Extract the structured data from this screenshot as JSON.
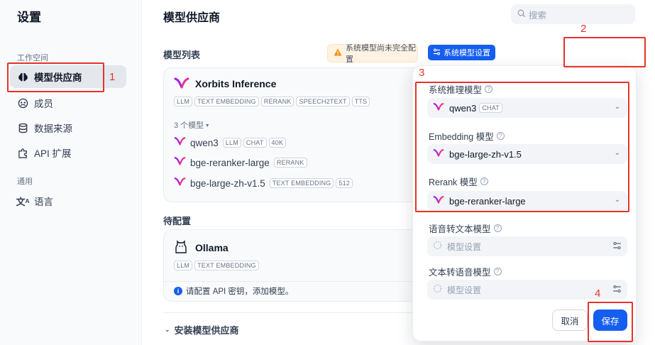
{
  "sidebar": {
    "title": "设置",
    "group_workspace": "工作空间",
    "group_general": "通用",
    "items": [
      {
        "label": "模型供应商"
      },
      {
        "label": "成员"
      },
      {
        "label": "数据来源"
      },
      {
        "label": "API 扩展"
      },
      {
        "label": "语言"
      }
    ]
  },
  "main": {
    "title": "模型供应商",
    "search_placeholder": "搜索",
    "model_list_label": "模型列表",
    "warning_text": "系统模型尚未完全配置",
    "system_model_button": "系统模型设置",
    "pending_label": "待配置",
    "install_label": "安装模型供应商"
  },
  "xorbits": {
    "name": "Xorbits Inference",
    "tags": [
      "LLM",
      "TEXT EMBEDDING",
      "RERANK",
      "SPEECH2TEXT",
      "TTS"
    ],
    "models_count": "3 个模型",
    "models": [
      {
        "name": "qwen3",
        "tags": [
          "LLM",
          "CHAT",
          "40K"
        ]
      },
      {
        "name": "bge-reranker-large",
        "tags": [
          "RERANK"
        ]
      },
      {
        "name": "bge-large-zh-v1.5",
        "tags": [
          "TEXT EMBEDDING",
          "512"
        ]
      }
    ]
  },
  "ollama": {
    "name": "Ollama",
    "tags": [
      "LLM",
      "TEXT EMBEDDING"
    ],
    "notice": "请配置 API 密钥，添加模型。"
  },
  "popup": {
    "reasoning_label": "系统推理模型",
    "reasoning_value": "qwen3",
    "reasoning_badge": "CHAT",
    "embedding_label": "Embedding 模型",
    "embedding_value": "bge-large-zh-v1.5",
    "rerank_label": "Rerank 模型",
    "rerank_value": "bge-reranker-large",
    "stt_label": "语音转文本模型",
    "stt_placeholder": "模型设置",
    "tts_label": "文本转语音模型",
    "tts_placeholder": "模型设置",
    "cancel": "取消",
    "save": "保存"
  },
  "callouts": [
    "1",
    "2",
    "3",
    "4"
  ],
  "colors": {
    "accent": "#155eef",
    "annotation": "#e5332a",
    "warning": "#f79009"
  }
}
